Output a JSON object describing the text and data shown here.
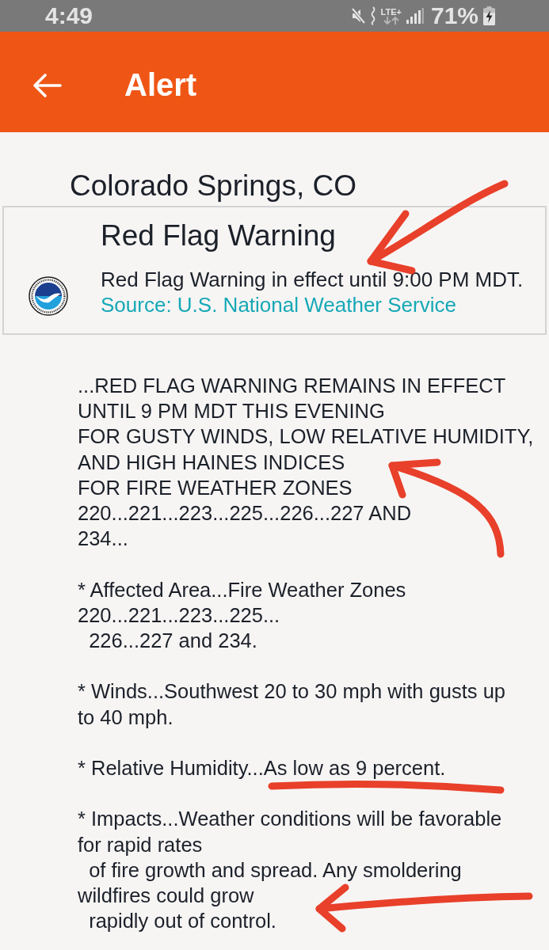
{
  "status_bar": {
    "time": "4:49",
    "network": "LTE+",
    "battery": "71%"
  },
  "app_bar": {
    "title": "Alert"
  },
  "location": "Colorado Springs, CO",
  "alert_card": {
    "title": "Red Flag Warning",
    "summary": "Red Flag Warning in effect until 9:00 PM MDT.",
    "source": "Source: U.S. National Weather Service",
    "annotation": {
      "kind": "diagonal"
    }
  },
  "paragraphs": [
    {
      "lines": [
        "...RED FLAG WARNING REMAINS IN EFFECT",
        "UNTIL 9 PM MDT THIS EVENING",
        "FOR GUSTY WINDS, LOW RELATIVE HUMIDITY,",
        "AND HIGH HAINES INDICES",
        "FOR FIRE WEATHER ZONES",
        "220...221...223...225...226...227 AND",
        "234..."
      ],
      "annotation": {
        "kind": "curved"
      }
    },
    {
      "lines": [
        "* Affected Area...Fire Weather Zones",
        "220...221...223...225...",
        "  226...227 and 234."
      ]
    },
    {
      "lines": [
        "* Winds...Southwest 20 to 30 mph with gusts up",
        "to 40 mph."
      ]
    },
    {
      "lines": [
        "* Relative Humidity...As low as 9 percent."
      ],
      "annotation": {
        "kind": "underline"
      }
    },
    {
      "lines": [
        "* Impacts...Weather conditions will be favorable",
        "for rapid rates",
        "  of fire growth and spread. Any smoldering",
        "wildfires could grow",
        "  rapidly out of control."
      ],
      "annotation": {
        "kind": "arrow"
      }
    }
  ]
}
